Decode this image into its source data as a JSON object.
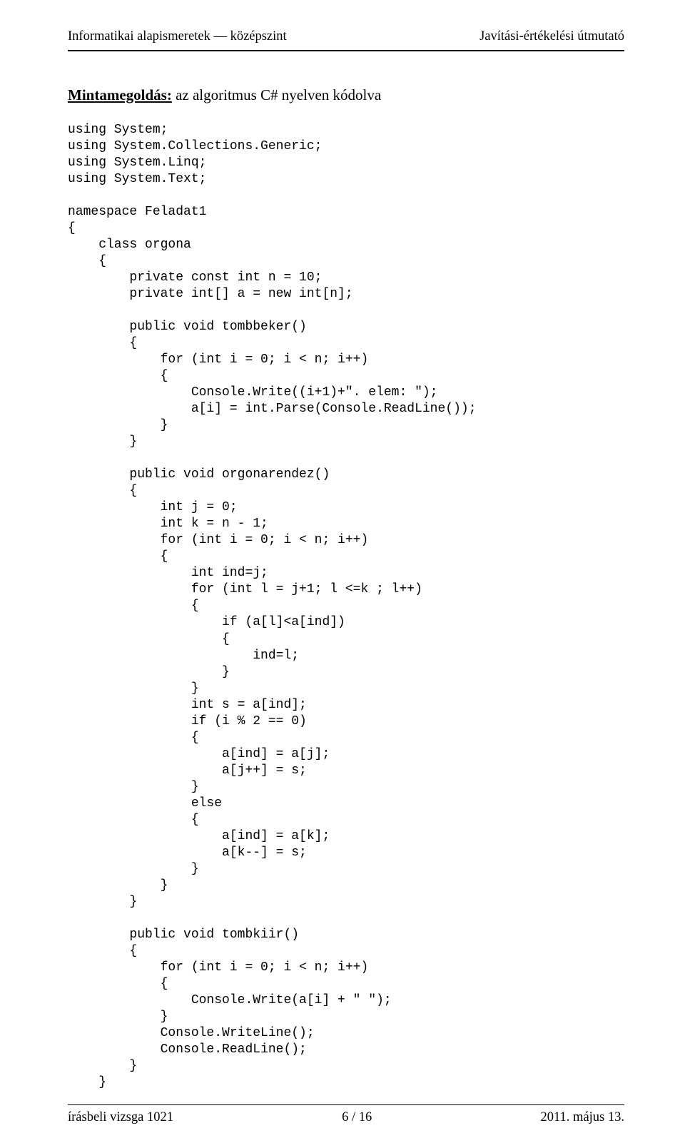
{
  "header": {
    "left": "Informatikai alapismeretek — középszint",
    "right": "Javítási-értékelési útmutató"
  },
  "title": {
    "lead": "Mintamegoldás:",
    "rest": "  az algoritmus C# nyelven kódolva"
  },
  "code": "using System;\nusing System.Collections.Generic;\nusing System.Linq;\nusing System.Text;\n\nnamespace Feladat1\n{\n    class orgona\n    {\n        private const int n = 10;\n        private int[] a = new int[n];\n\n        public void tombbeker()\n        {\n            for (int i = 0; i < n; i++)\n            {\n                Console.Write((i+1)+\". elem: \");\n                a[i] = int.Parse(Console.ReadLine());\n            }\n        }\n\n        public void orgonarendez()\n        {\n            int j = 0;\n            int k = n - 1;\n            for (int i = 0; i < n; i++)\n            {\n                int ind=j;\n                for (int l = j+1; l <=k ; l++)\n                {\n                    if (a[l]<a[ind])\n                    {\n                        ind=l;\n                    }\n                }\n                int s = a[ind];\n                if (i % 2 == 0)\n                {\n                    a[ind] = a[j];\n                    a[j++] = s;\n                }\n                else\n                {\n                    a[ind] = a[k];\n                    a[k--] = s;\n                }\n            }\n        }\n\n        public void tombkiir()\n        {\n            for (int i = 0; i < n; i++)\n            {\n                Console.Write(a[i] + \" \");\n            }\n            Console.WriteLine();\n            Console.ReadLine();\n        }\n    }",
  "footer": {
    "left": "írásbeli vizsga 1021",
    "center": "6 / 16",
    "right": "2011. május 13."
  }
}
